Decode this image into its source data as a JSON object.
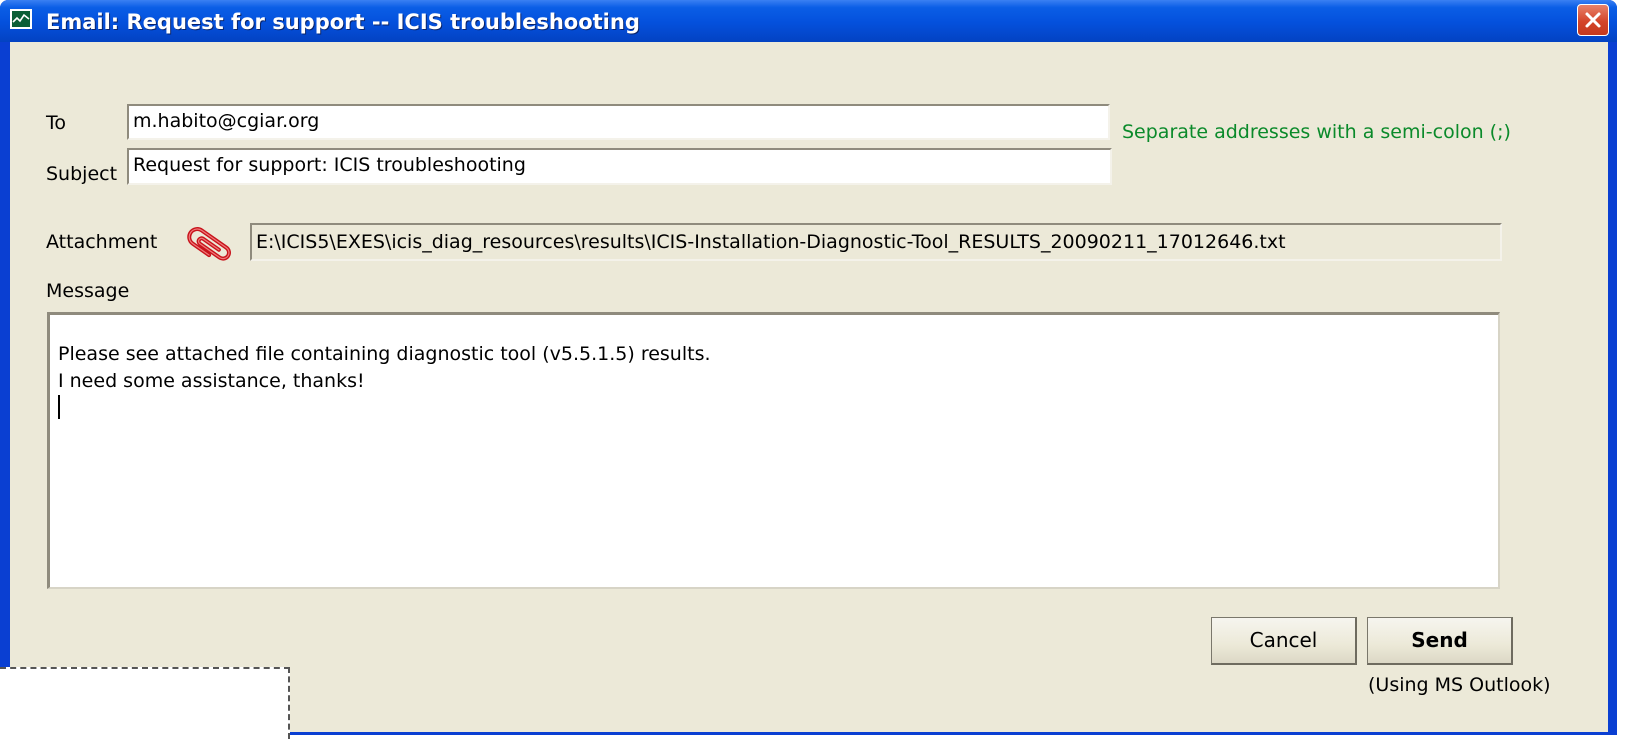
{
  "window": {
    "title": "Email: Request for support -- ICIS troubleshooting",
    "icon": "monitor-chart-icon",
    "close_icon": "close-icon"
  },
  "form": {
    "to_label": "To",
    "to_value": "m.habito@cgiar.org",
    "to_hint": "Separate addresses with a semi-colon (;)",
    "subject_label": "Subject",
    "subject_value": "Request for support: ICIS troubleshooting",
    "attachment_label": "Attachment",
    "attachment_icon": "paperclip-icon",
    "attachment_value": "E:\\ICIS5\\EXES\\icis_diag_resources\\results\\ICIS-Installation-Diagnostic-Tool_RESULTS_20090211_17012646.txt",
    "message_label": "Message",
    "message_lines": [
      "Please see attached file containing diagnostic tool (v5.5.1.5) results.",
      "I need some assistance, thanks!"
    ]
  },
  "buttons": {
    "cancel_label": "Cancel",
    "send_label": "Send",
    "send_note": "(Using MS Outlook)"
  },
  "colors": {
    "titlebar": "#0450dc",
    "client": "#ece9d8",
    "hint": "#0a8a2a",
    "close": "#d4452a"
  }
}
